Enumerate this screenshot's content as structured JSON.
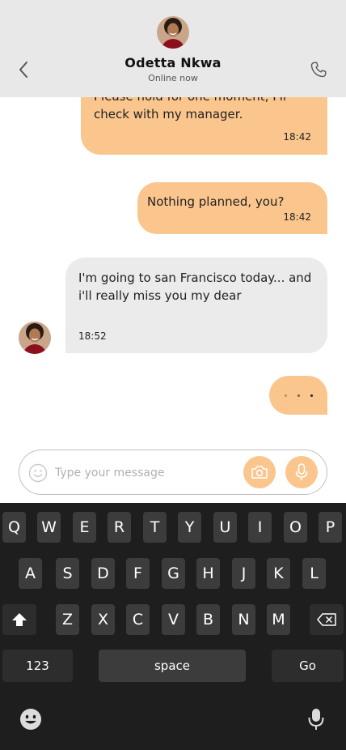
{
  "header": {
    "name": "Odetta Nkwa",
    "status": "Online now"
  },
  "messages": [
    {
      "text": "Please hold for one moment, I'll check with my manager.",
      "time": "18:42"
    },
    {
      "text": "Nothing planned, you?",
      "time": "18:42"
    },
    {
      "text": "I'm going to san Francisco today... and i'll really miss you my dear",
      "time": "18:52"
    }
  ],
  "input": {
    "placeholder": "Type your message"
  },
  "keyboard": {
    "row1": [
      "Q",
      "W",
      "E",
      "R",
      "T",
      "Y",
      "U",
      "I",
      "O",
      "P"
    ],
    "row2": [
      "A",
      "S",
      "D",
      "F",
      "G",
      "H",
      "J",
      "K",
      "L"
    ],
    "row3": [
      "Z",
      "X",
      "C",
      "V",
      "B",
      "N",
      "M"
    ],
    "numbers_label": "123",
    "space_label": "space",
    "go_label": "Go"
  },
  "colors": {
    "accent": "#fbc68e",
    "incoming": "#ebebeb",
    "header_bg": "#e8e8e8",
    "keyboard_bg": "#1e1e1e",
    "key_bg": "#3c3c3c"
  },
  "icons": [
    "back-icon",
    "phone-icon",
    "emoji-icon",
    "camera-icon",
    "microphone-icon",
    "shift-icon",
    "backspace-icon",
    "smiley-icon",
    "dictation-icon"
  ]
}
